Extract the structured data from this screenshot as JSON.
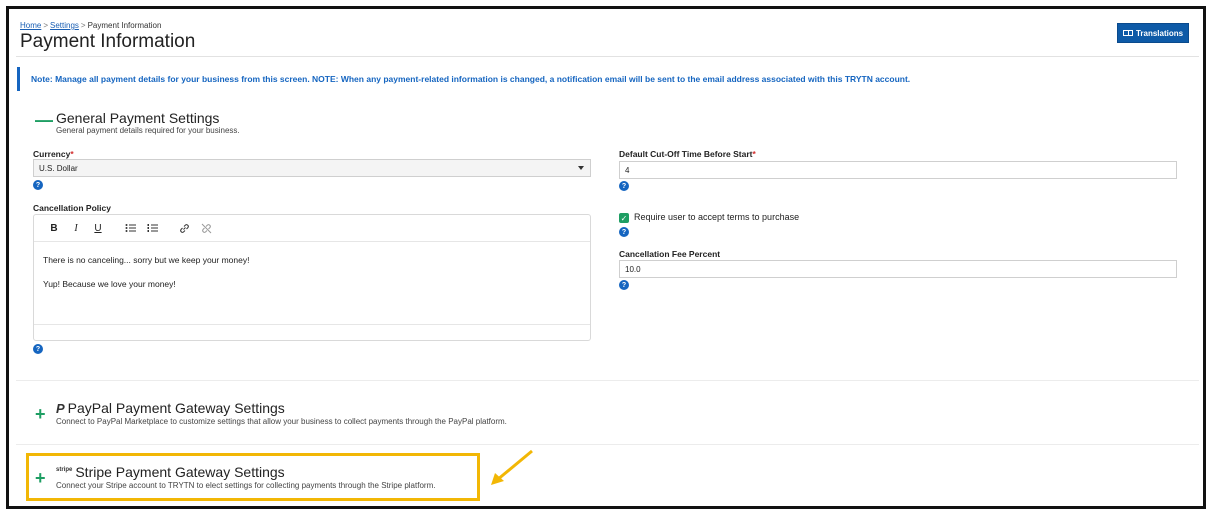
{
  "breadcrumb": {
    "home": "Home",
    "settings": "Settings",
    "current": "Payment Information",
    "sep": ">"
  },
  "page_title": "Payment Information",
  "translations_button": "Translations",
  "note": "Note: Manage all payment details for your business from this screen. NOTE: When any payment-related information is changed, a notification email will be sent to the email address associated with this TRYTN account.",
  "general": {
    "toggle": "—",
    "title": "General Payment Settings",
    "description": "General payment details required for your business.",
    "currency_label": "Currency",
    "currency_value": "U.S. Dollar",
    "cutoff_label": "Default Cut-Off Time Before Start",
    "cutoff_value": "4",
    "cancellation_policy_label": "Cancellation Policy",
    "cancellation_policy_lines": [
      "There is no canceling... sorry but we keep your money!",
      "Yup!  Because we love your money!"
    ],
    "require_terms_label": "Require user to accept terms to purchase",
    "require_terms_checked": true,
    "fee_label": "Cancellation Fee Percent",
    "fee_value": "10.0",
    "required_mark": "*",
    "help_glyph": "?",
    "check_glyph": "✓"
  },
  "editor_toolbar": {
    "bold": "B",
    "italic": "I",
    "underline": "U"
  },
  "paypal": {
    "toggle": "+",
    "logo": "P",
    "title": "PayPal Payment Gateway Settings",
    "description": "Connect to PayPal Marketplace to customize settings that allow your business to collect payments through the PayPal platform."
  },
  "stripe": {
    "toggle": "+",
    "logo": "stripe",
    "title": "Stripe Payment Gateway Settings",
    "description": "Connect your Stripe account to TRYTN to elect settings for collecting payments through the Stripe platform."
  },
  "colors": {
    "primary": "#1565c0",
    "green": "#1e9e63",
    "highlight": "#f2b705",
    "button": "#0d5aa7"
  }
}
